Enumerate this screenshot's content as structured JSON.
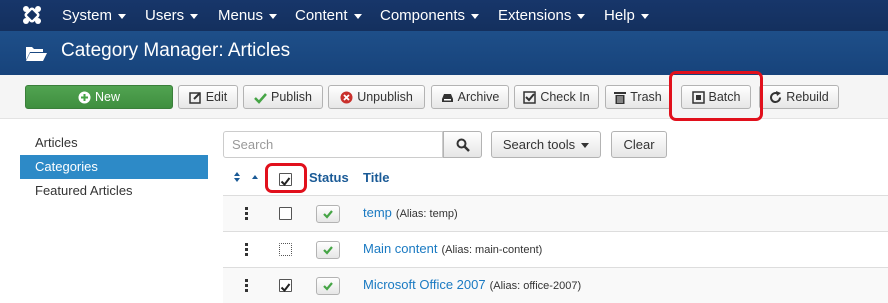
{
  "topmenu": [
    {
      "label": "System"
    },
    {
      "label": "Users"
    },
    {
      "label": "Menus"
    },
    {
      "label": "Content"
    },
    {
      "label": "Components"
    },
    {
      "label": "Extensions"
    },
    {
      "label": "Help"
    }
  ],
  "header": {
    "title": "Category Manager: Articles",
    "icon": "folder-open-icon"
  },
  "toolbar": {
    "new": "New",
    "edit": "Edit",
    "publish": "Publish",
    "unpublish": "Unpublish",
    "archive": "Archive",
    "checkin": "Check In",
    "trash": "Trash",
    "batch": "Batch",
    "rebuild": "Rebuild"
  },
  "sidebar": {
    "items": [
      {
        "label": "Articles",
        "active": false
      },
      {
        "label": "Categories",
        "active": true
      },
      {
        "label": "Featured Articles",
        "active": false
      }
    ]
  },
  "filter": {
    "search_placeholder": "Search",
    "search_tools": "Search tools",
    "clear": "Clear"
  },
  "table": {
    "headers": {
      "status": "Status",
      "title": "Title"
    },
    "select_all_checked": true,
    "rows": [
      {
        "title": "temp",
        "alias": "(Alias: temp)",
        "checked": false,
        "published": true
      },
      {
        "title": "Main content",
        "alias": "(Alias: main-content)",
        "checked": false,
        "published": true
      },
      {
        "title": "Microsoft Office 2007",
        "alias": "(Alias: office-2007)",
        "checked": true,
        "published": true
      }
    ]
  },
  "colors": {
    "topbar": "#17366a",
    "header": "#1e4f89",
    "highlight": "#e1101c",
    "active": "#2d8ac7",
    "link": "#1a7ac2",
    "success": "#46a546"
  }
}
